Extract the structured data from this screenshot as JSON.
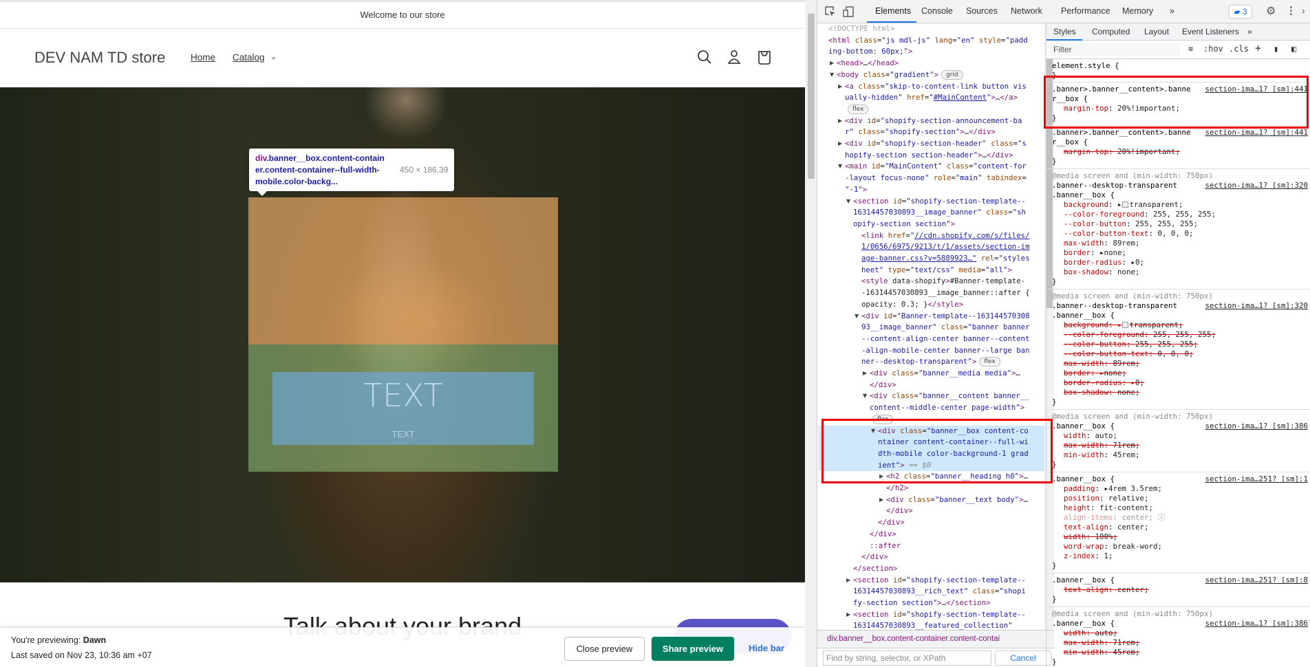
{
  "store": {
    "announcement": "Welcome to our store",
    "logo": "DEV NAM TD store",
    "nav": [
      "Home",
      "Catalog"
    ],
    "hero_heading": "TEXT",
    "hero_text": "TEXT",
    "rich_text_heading": "Talk about your brand"
  },
  "inspect_tooltip": {
    "tag": "div",
    "selector_rest_1": ".banner__box.content-contain",
    "selector_2": "er.content-container--full-width-",
    "selector_3": "mobile.color-backg...",
    "dimensions": "450 × 186.39"
  },
  "preview_bar": {
    "previewing_label": "You're previewing: ",
    "theme": "Dawn",
    "last_saved": "Last saved on Nov 23, 10:36 am +07",
    "close_label": "Close preview",
    "share_label": "Share preview",
    "hide_label": "Hide bar"
  },
  "devtools": {
    "tabs": [
      "Elements",
      "Console",
      "Sources",
      "Network",
      "Performance",
      "Memory"
    ],
    "more_tabs": "»",
    "issues_count": "3",
    "styles_tabs": [
      "Styles",
      "Computed",
      "Layout",
      "Event Listeners"
    ],
    "filter_placeholder": "Filter",
    "hov": ":hov",
    "cls": ".cls",
    "breadcrumb": "div.banner__box.content-container.content-contai",
    "find_placeholder": "Find by string, selector, or XPath",
    "cancel": "Cancel",
    "dom_lines": [
      {
        "lvl": 0,
        "text": "<!DOCTYPE html>",
        "start": "c"
      },
      {
        "lvl": 0,
        "text": "<html class=\"js mdl-js\" lang=\"en\" style=\"padd"
      },
      {
        "lvl": 0,
        "text": "ing-bottom: 60px;\">",
        "start": "v"
      },
      {
        "lvl": 1,
        "arrow": "▶",
        "text": "<head>…</head>"
      },
      {
        "lvl": 1,
        "arrow": "▼",
        "text": "<body class=\"gradient\">",
        "badge": "grid"
      },
      {
        "lvl": 2,
        "arrow": "▶",
        "text": "<a class=\"skip-to-content-link button vis"
      },
      {
        "lvl": 2,
        "text": "ually-hidden\" href=\"#MainContent\">…</a>",
        "start": "v",
        "link": "#MainContent"
      },
      {
        "lvl": 2,
        "text": "",
        "badge": "flex"
      },
      {
        "lvl": 2,
        "arrow": "▶",
        "text": "<div id=\"shopify-section-announcement-ba"
      },
      {
        "lvl": 2,
        "text": "r\" class=\"shopify-section\">…</div>",
        "start": "v"
      },
      {
        "lvl": 2,
        "arrow": "▶",
        "text": "<div id=\"shopify-section-header\" class=\"s"
      },
      {
        "lvl": 2,
        "text": "hopify-section section-header\">…</div>",
        "start": "v"
      },
      {
        "lvl": 2,
        "arrow": "▼",
        "text": "<main id=\"MainContent\" class=\"content-for"
      },
      {
        "lvl": 2,
        "text": "-layout focus-none\" role=\"main\" tabindex=",
        "start": "v"
      },
      {
        "lvl": 2,
        "text": "\"-1\">"
      },
      {
        "lvl": 3,
        "arrow": "▼",
        "text": "<section id=\"shopify-section-template--"
      },
      {
        "lvl": 3,
        "text": "16314457030893__image_banner\" class=\"sh",
        "start": "v"
      },
      {
        "lvl": 3,
        "text": "opify-section section\">",
        "start": "v"
      },
      {
        "lvl": 4,
        "text": "<link href=\"//cdn.shopify.com/s/files/",
        "link": "//cdn.shopify.com/s/files/"
      },
      {
        "lvl": 4,
        "text": "1/0656/6975/9213/t/1/assets/section-im",
        "start": "l"
      },
      {
        "lvl": 4,
        "text": "age-banner.css?v=5889923…\" rel=\"styles",
        "start": "l",
        "linkend": "age-banner.css?v=5889923…"
      },
      {
        "lvl": 4,
        "text": "heet\" type=\"text/css\" media=\"all\">",
        "start": "v"
      },
      {
        "lvl": 4,
        "text": "<style data-shopify>#Banner-template-"
      },
      {
        "lvl": 4,
        "text": "-16314457030893__image_banner::after {",
        "start": "p"
      },
      {
        "lvl": 4,
        "text": "opacity: 0.3; }</style>",
        "start": "p"
      },
      {
        "lvl": 4,
        "arrow": "▼",
        "text": "<div id=\"Banner-template--163144570308"
      },
      {
        "lvl": 4,
        "text": "93__image_banner\" class=\"banner banner",
        "start": "v"
      },
      {
        "lvl": 4,
        "text": "--content-align-center banner--content",
        "start": "v"
      },
      {
        "lvl": 4,
        "text": "-align-mobile-center banner--large ban",
        "start": "v"
      },
      {
        "lvl": 4,
        "text": "ner--desktop-transparent\">",
        "start": "v",
        "badge": "flex"
      },
      {
        "lvl": 5,
        "arrow": "▶",
        "text": "<div class=\"banner__media media\">…"
      },
      {
        "lvl": 5,
        "text": "</div>"
      },
      {
        "lvl": 5,
        "arrow": "▼",
        "text": "<div class=\"banner__content banner__"
      },
      {
        "lvl": 5,
        "text": "content--middle-center page-width\">",
        "start": "v"
      },
      {
        "lvl": 5,
        "text": "",
        "badge": "flex"
      },
      {
        "lvl": 6,
        "arrow": "▼",
        "text": "<div class=\"banner__box content-co",
        "sel": true
      },
      {
        "lvl": 6,
        "text": "ntainer content-container--full-wi",
        "start": "v",
        "sel": true
      },
      {
        "lvl": 6,
        "text": "dth-mobile color-background-1 grad",
        "start": "v",
        "sel": true
      },
      {
        "lvl": 6,
        "text": "ient\">",
        "start": "v",
        "sel": true,
        "suffix": " == $0"
      },
      {
        "lvl": 7,
        "arrow": "▶",
        "text": "<h2 class=\"banner__heading h0\">…"
      },
      {
        "lvl": 7,
        "text": "</h2>"
      },
      {
        "lvl": 7,
        "arrow": "▶",
        "text": "<div class=\"banner__text body\">…"
      },
      {
        "lvl": 7,
        "text": "</div>"
      },
      {
        "lvl": 6,
        "text": "</div>"
      },
      {
        "lvl": 5,
        "text": "</div>"
      },
      {
        "lvl": 5,
        "text": "::after",
        "start": "t"
      },
      {
        "lvl": 4,
        "text": "</div>"
      },
      {
        "lvl": 3,
        "text": "</section>"
      },
      {
        "lvl": 3,
        "arrow": "▶",
        "text": "<section id=\"shopify-section-template--"
      },
      {
        "lvl": 3,
        "text": "16314457030893__rich_text\" class=\"shopi",
        "start": "v"
      },
      {
        "lvl": 3,
        "text": "fy-section section\">…</section>",
        "start": "v"
      },
      {
        "lvl": 3,
        "arrow": "▶",
        "text": "<section id=\"shopify-section-template--"
      },
      {
        "lvl": 3,
        "text": "16314457030893__featured_collection\"",
        "start": "v"
      }
    ],
    "style_rules": [
      {
        "selector": [
          "element.style {"
        ],
        "props": []
      },
      {
        "selector": [
          ".banner>.banner__content>.banne",
          "r__box {"
        ],
        "source": "section-ima…1? [sm]:441",
        "props": [
          {
            "n": "margin-top",
            "v": "20%!important;"
          }
        ]
      },
      {
        "selector": [
          ".banner>.banner__content>.banne",
          "r__box {"
        ],
        "source": "section-ima…1? [sm]:441",
        "props": [
          {
            "n": "margin-top",
            "v": "20%!important;",
            "strike": true
          }
        ]
      },
      {
        "media": "@media screen and (min-width: 750px)",
        "selector": [
          ".banner--desktop-transparent",
          ".banner__box {"
        ],
        "source": "section-ima…1? [sm]:320",
        "props": [
          {
            "n": "background",
            "v": "transparent;",
            "arrow": true,
            "swatch": true
          },
          {
            "n": "--color-foreground",
            "v": "255, 255, 255;"
          },
          {
            "n": "--color-button",
            "v": "255, 255, 255;"
          },
          {
            "n": "--color-button-text",
            "v": "0, 0, 0;"
          },
          {
            "n": "max-width",
            "v": "89rem;"
          },
          {
            "n": "border",
            "v": "none;",
            "arrow": true
          },
          {
            "n": "border-radius",
            "v": "0;",
            "arrow": true
          },
          {
            "n": "box-shadow",
            "v": "none;"
          }
        ]
      },
      {
        "media": "@media screen and (min-width: 750px)",
        "selector": [
          ".banner--desktop-transparent",
          ".banner__box {"
        ],
        "source": "section-ima…1? [sm]:320",
        "props": [
          {
            "n": "background",
            "v": "transparent;",
            "arrow": true,
            "swatch": true,
            "strike": true
          },
          {
            "n": "--color-foreground",
            "v": "255, 255, 255;",
            "strike": true
          },
          {
            "n": "--color-button",
            "v": "255, 255, 255;",
            "strike": true
          },
          {
            "n": "--color-button-text",
            "v": "0, 0, 0;",
            "strike": true
          },
          {
            "n": "max-width",
            "v": "89rem;",
            "strike": true
          },
          {
            "n": "border",
            "v": "none;",
            "arrow": true,
            "strike": true
          },
          {
            "n": "border-radius",
            "v": "0;",
            "arrow": true,
            "strike": true
          },
          {
            "n": "box-shadow",
            "v": "none;",
            "strike": true
          }
        ]
      },
      {
        "media": "@media screen and (min-width: 750px)",
        "selector": [
          ".banner__box {"
        ],
        "source": "section-ima…1? [sm]:386",
        "props": [
          {
            "n": "width",
            "v": "auto;"
          },
          {
            "n": "max-width",
            "v": "71rem;",
            "strike": true
          },
          {
            "n": "min-width",
            "v": "45rem;"
          }
        ]
      },
      {
        "selector": [
          ".banner__box {"
        ],
        "source": "section-ima…251? [sm]:1",
        "props": [
          {
            "n": "padding",
            "v": "4rem 3.5rem;",
            "arrow": true
          },
          {
            "n": "position",
            "v": "relative;"
          },
          {
            "n": "height",
            "v": "fit-content;"
          },
          {
            "n": "align-items",
            "v": "center;",
            "dim": true,
            "info": true
          },
          {
            "n": "text-align",
            "v": "center;"
          },
          {
            "n": "width",
            "v": "100%;",
            "strike": true
          },
          {
            "n": "word-wrap",
            "v": "break-word;"
          },
          {
            "n": "z-index",
            "v": "1;"
          }
        ]
      },
      {
        "selector": [
          ".banner__box {"
        ],
        "source": "section-ima…251? [sm]:8",
        "props": [
          {
            "n": "text-align",
            "v": "center;",
            "strike": true
          }
        ]
      },
      {
        "media": "@media screen and (min-width: 750px)",
        "selector": [
          ".banner__box {"
        ],
        "source": "section-ima…1? [sm]:386",
        "props": [
          {
            "n": "width",
            "v": "auto;",
            "strike": true
          },
          {
            "n": "max-width",
            "v": "71rem;",
            "strike": true
          },
          {
            "n": "min-width",
            "v": "45rem;",
            "strike": true
          }
        ]
      }
    ]
  },
  "colors": {
    "highlight_margin": "#f6b26b",
    "highlight_padding": "#93c47d",
    "highlight_content": "#6fa8dc",
    "share_button": "#008060",
    "annotation": "#e00000"
  }
}
